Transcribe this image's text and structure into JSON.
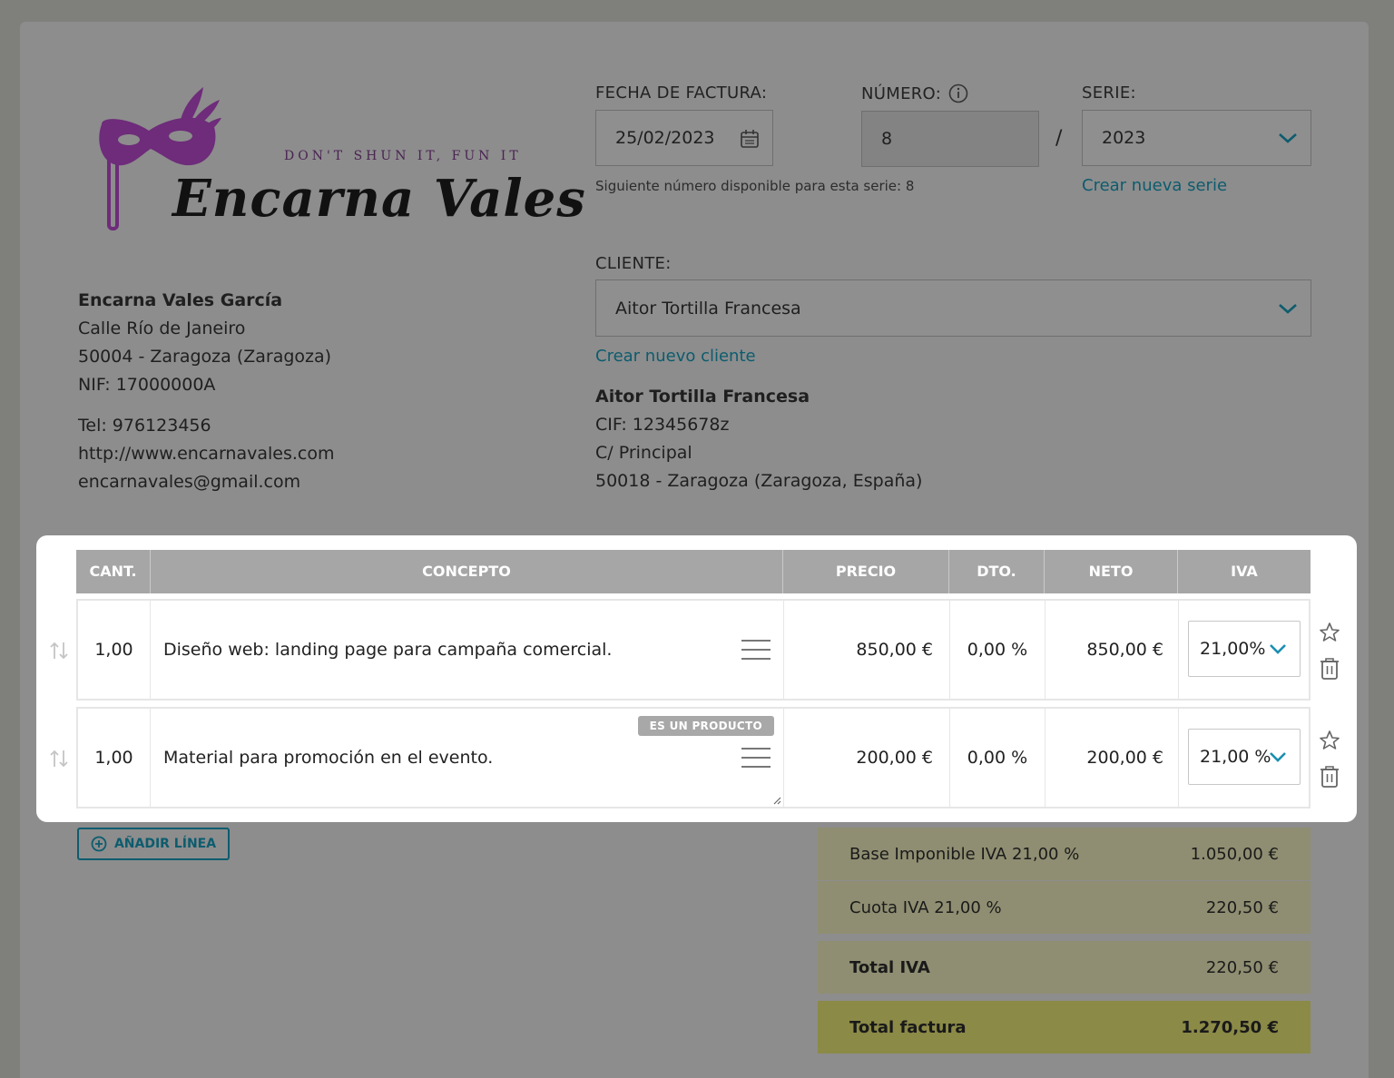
{
  "company": {
    "logo_tagline": "DON'T SHUN IT, FUN IT",
    "logo_name": "Encarna Vales",
    "name": "Encarna Vales García",
    "address": "Calle Río de Janeiro",
    "city": "50004 - Zaragoza (Zaragoza)",
    "nif": "NIF: 17000000A",
    "tel": "Tel: 976123456",
    "web": "http://www.encarnavales.com",
    "email": "encarnavales@gmail.com"
  },
  "invoice": {
    "date_label": "FECHA DE FACTURA:",
    "date_value": "25/02/2023",
    "number_label": "NÚMERO:",
    "number_value": "8",
    "separator": "/",
    "series_label": "SERIE:",
    "series_value": "2023",
    "next_hint": "Siguiente número disponible para esta serie: 8",
    "new_series_link": "Crear nueva serie"
  },
  "client": {
    "label": "CLIENTE:",
    "selected": "Aitor Tortilla Francesa",
    "new_client_link": "Crear nuevo cliente",
    "name": "Aitor Tortilla Francesa",
    "cif": "CIF: 12345678z",
    "address": "C/ Principal",
    "city": "50018 - Zaragoza (Zaragoza, España)"
  },
  "table": {
    "headers": [
      "CANT.",
      "CONCEPTO",
      "PRECIO",
      "DTO.",
      "NETO",
      "IVA"
    ],
    "rows": [
      {
        "qty": "1,00",
        "concept": "Diseño web: landing page para campaña comercial.",
        "price": "850,00 €",
        "discount": "0,00 %",
        "net": "850,00 €",
        "iva": "21,00%",
        "badge": ""
      },
      {
        "qty": "1,00",
        "concept": "Material para promoción en el evento.",
        "price": "200,00 €",
        "discount": "0,00 %",
        "net": "200,00 €",
        "iva": "21,00 %",
        "badge": "ES UN PRODUCTO"
      }
    ]
  },
  "add_line_label": "AÑADIR LÍNEA",
  "totals": {
    "base_label": "Base Imponible IVA 21,00 %",
    "base_value": "1.050,00 €",
    "quota_label": "Cuota IVA 21,00 %",
    "quota_value": "220,50 €",
    "total_iva_label": "Total IVA",
    "total_iva_value": "220,50 €",
    "total_label": "Total factura",
    "total_value": "1.270,50 €"
  },
  "colors": {
    "accent": "#0d5c6e",
    "brand": "#6e2c7a",
    "totals_bg": "#8f8e72",
    "total_final_bg": "#8b8a47",
    "iva_chevron": "#1a8fb0"
  }
}
